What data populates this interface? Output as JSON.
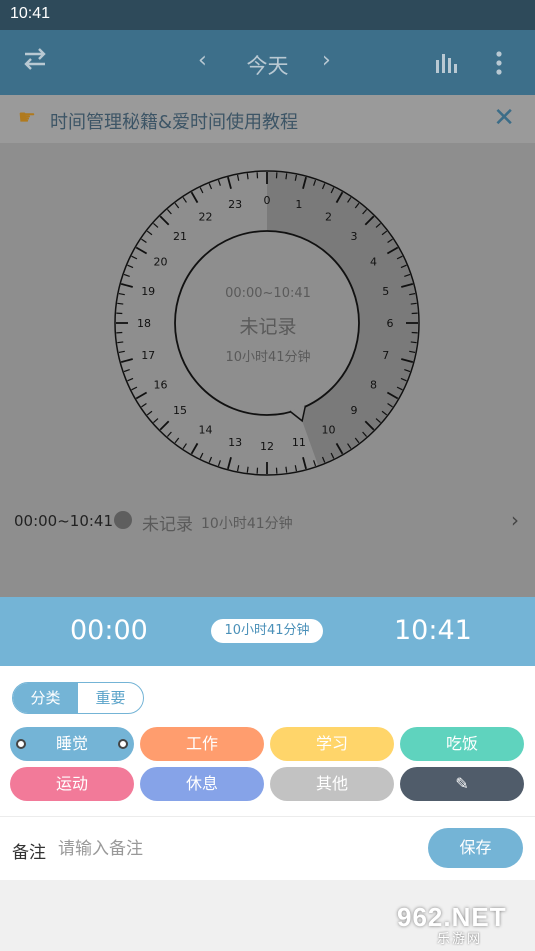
{
  "status_bar": {
    "time": "10:41"
  },
  "toolbar": {
    "title": "今天",
    "swap_icon": "swap-icon",
    "prev_icon": "chevron-left-icon",
    "next_icon": "chevron-right-icon",
    "stats_icon": "bar-chart-icon",
    "menu_icon": "more-vertical-icon"
  },
  "banner": {
    "text": "时间管理秘籍&爱时间使用教程",
    "icon": "pointing-hand-icon",
    "close_icon": "close-icon"
  },
  "clock": {
    "hours": [
      "0",
      "1",
      "2",
      "3",
      "4",
      "5",
      "6",
      "7",
      "8",
      "9",
      "10",
      "11",
      "12",
      "13",
      "14",
      "15",
      "16",
      "17",
      "18",
      "19",
      "20",
      "21",
      "22",
      "23"
    ],
    "center_range": "00:00~10:41",
    "center_label": "未记录",
    "center_duration": "10小时41分钟",
    "shaded_from_hour": 0,
    "shaded_to_hour": 10.683
  },
  "record_row": {
    "range": "00:00~10:41",
    "label": "未记录",
    "duration": "10小时41分钟",
    "chevron_icon": "chevron-right-icon"
  },
  "sheet": {
    "start_time": "00:00",
    "end_time": "10:41",
    "duration_pill": "10小时41分钟",
    "segment": {
      "left": "分类",
      "right": "重要",
      "selected": "分类"
    },
    "categories": [
      {
        "label": "睡觉",
        "color": "#74b4d6",
        "selected": true
      },
      {
        "label": "工作",
        "color": "#ff9d6e"
      },
      {
        "label": "学习",
        "color": "#ffd56a"
      },
      {
        "label": "吃饭",
        "color": "#5fd3be"
      },
      {
        "label": "运动",
        "color": "#f27a99"
      },
      {
        "label": "休息",
        "color": "#86a3e8"
      },
      {
        "label": "其他",
        "color": "#c2c2c2"
      },
      {
        "label": "✎",
        "color": "#505c6a",
        "icon": "edit-icon"
      }
    ],
    "note_label": "备注",
    "note_placeholder": "请输入备注",
    "note_value": "",
    "save_label": "保存"
  },
  "watermark": {
    "big": "962.NET",
    "small": "乐游网"
  }
}
